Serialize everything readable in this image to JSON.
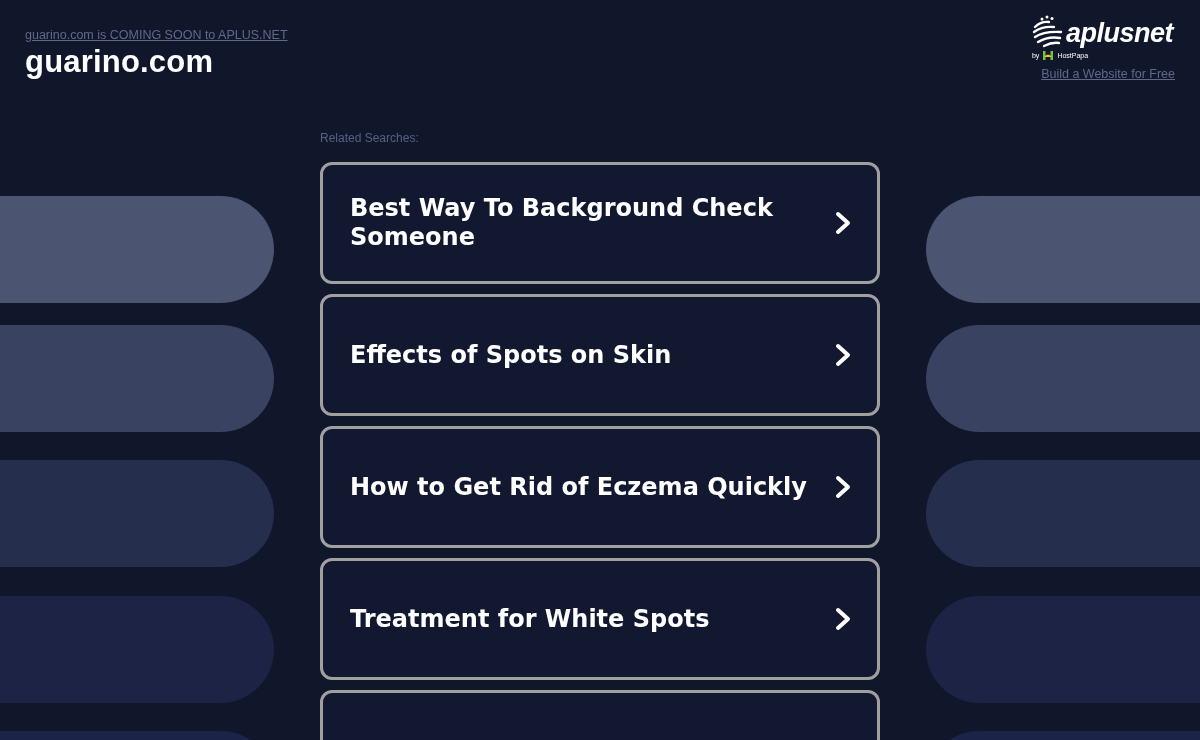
{
  "header": {
    "notice_link": "guarino.com is COMING SOON to APLUS.NET",
    "domain": "guarino.com"
  },
  "brand": {
    "name": "aplusnet",
    "byline": "by",
    "partner": "HostPapa",
    "link": "Build a Website for Free"
  },
  "related": {
    "label": "Related Searches:",
    "links": [
      {
        "kind": "full",
        "label": "Best Way To Background Check Someone"
      },
      {
        "kind": "full",
        "label": "Effects of Spots on Skin"
      },
      {
        "kind": "full",
        "label": "How to Get Rid of Eczema Quickly"
      },
      {
        "kind": "full",
        "label": "Treatment for White Spots"
      },
      {
        "kind": "cut"
      }
    ]
  }
}
